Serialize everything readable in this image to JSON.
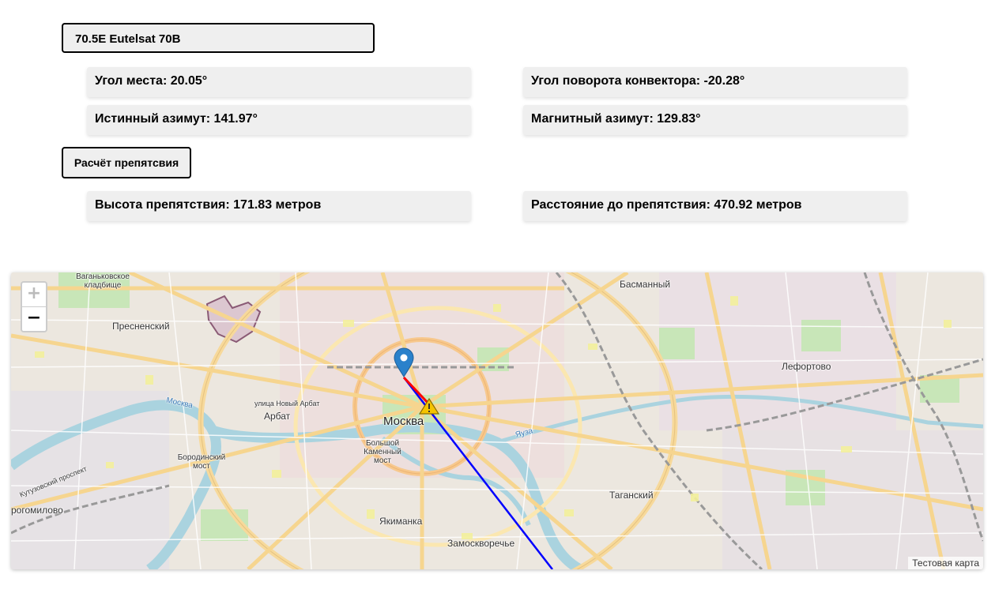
{
  "satellite": {
    "selected": "70.5E Eutelsat 70B"
  },
  "results": {
    "elevation": "Угол места: 20.05°",
    "converter_rotation": "Угол поворота конвектора: -20.28°",
    "true_azimuth": "Истинный азимут: 141.97°",
    "magnetic_azimuth": "Магнитный азимут: 129.83°"
  },
  "obstacle_button": "Расчёт препятсвия",
  "obstacle": {
    "height": "Высота препятствия: 171.83 метров",
    "distance": "Расстояние до препятствия: 470.92 метров"
  },
  "map": {
    "zoom_in": "+",
    "zoom_out": "−",
    "attribution": "Тестовая карта",
    "labels": {
      "vagankovskoe": "Ваганьковское кладбище",
      "presnensky": "Пресненский",
      "basmanny": "Басманный",
      "lefortovo": "Лефортово",
      "moskva": "Москва",
      "arbat": "Арбат",
      "novy_arbat": "улица Новый Арбат",
      "borodinsky": "Бородинский мост",
      "bolshoy_kamenny": "Большой Каменный мост",
      "yakimanka": "Якиманка",
      "zamoskvorechye": "Замоскворечье",
      "tagansky": "Таганский",
      "dorogomilovo": "рогомилово",
      "kutuzovsky": "Кутузовский проспект",
      "yauza": "Яуза",
      "moskva_river": "Москва"
    },
    "colors": {
      "azimuth_line": "#0000ff",
      "obstacle_segment": "#ff0000",
      "marker": "#2a81cb",
      "warning": "#f5c400"
    }
  }
}
